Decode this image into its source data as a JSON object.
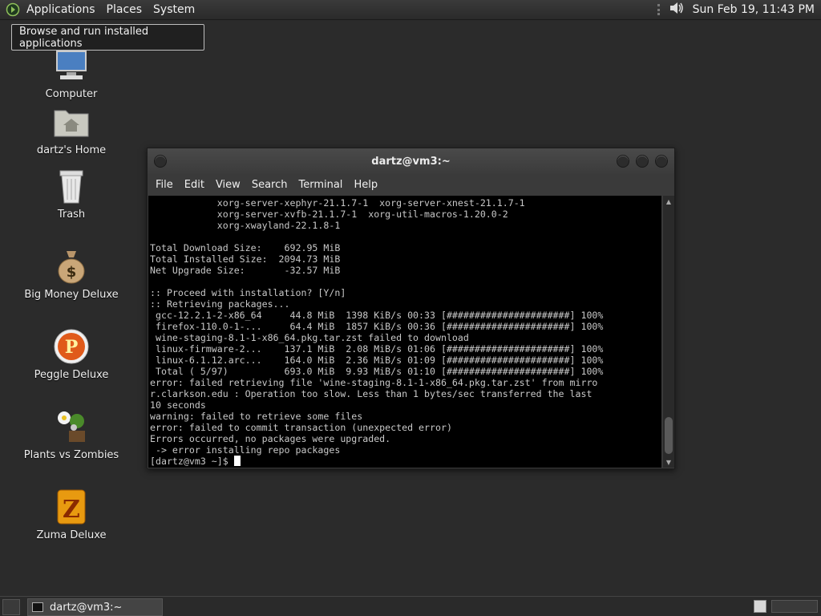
{
  "top_panel": {
    "menus": [
      "Applications",
      "Places",
      "System"
    ],
    "clock": "Sun Feb 19, 11:43 PM",
    "volume_icon": "speaker-icon"
  },
  "tooltip": "Browse and run installed applications",
  "desktop_icons": [
    {
      "label": "Computer",
      "icon": "computer-icon"
    },
    {
      "label": "dartz's Home",
      "icon": "home-folder-icon"
    },
    {
      "label": "Trash",
      "icon": "trash-icon"
    },
    {
      "label": "Big Money Deluxe",
      "icon": "money-bag-icon"
    },
    {
      "label": "Peggle Deluxe",
      "icon": "peggle-icon"
    },
    {
      "label": "Plants vs Zombies",
      "icon": "plants-icon"
    },
    {
      "label": "Zuma Deluxe",
      "icon": "zuma-icon"
    }
  ],
  "terminal": {
    "title": "dartz@vm3:~",
    "menus": [
      "File",
      "Edit",
      "View",
      "Search",
      "Terminal",
      "Help"
    ],
    "lines": [
      "            xorg-server-xephyr-21.1.7-1  xorg-server-xnest-21.1.7-1",
      "            xorg-server-xvfb-21.1.7-1  xorg-util-macros-1.20.0-2",
      "            xorg-xwayland-22.1.8-1",
      "",
      "Total Download Size:    692.95 MiB",
      "Total Installed Size:  2094.73 MiB",
      "Net Upgrade Size:       -32.57 MiB",
      "",
      ":: Proceed with installation? [Y/n]",
      ":: Retrieving packages...",
      " gcc-12.2.1-2-x86_64     44.8 MiB  1398 KiB/s 00:33 [######################] 100%",
      " firefox-110.0-1-...     64.4 MiB  1857 KiB/s 00:36 [######################] 100%",
      " wine-staging-8.1-1-x86_64.pkg.tar.zst failed to download",
      " linux-firmware-2...    137.1 MiB  2.08 MiB/s 01:06 [######################] 100%",
      " linux-6.1.12.arc...    164.0 MiB  2.36 MiB/s 01:09 [######################] 100%",
      " Total ( 5/97)          693.0 MiB  9.93 MiB/s 01:10 [######################] 100%",
      "error: failed retrieving file 'wine-staging-8.1-1-x86_64.pkg.tar.zst' from mirro",
      "r.clarkson.edu : Operation too slow. Less than 1 bytes/sec transferred the last",
      "10 seconds",
      "warning: failed to retrieve some files",
      "error: failed to commit transaction (unexpected error)",
      "Errors occurred, no packages were upgraded.",
      " -> error installing repo packages"
    ],
    "prompt": "[dartz@vm3 ~]$ "
  },
  "taskbar": {
    "task_label": "dartz@vm3:~"
  }
}
